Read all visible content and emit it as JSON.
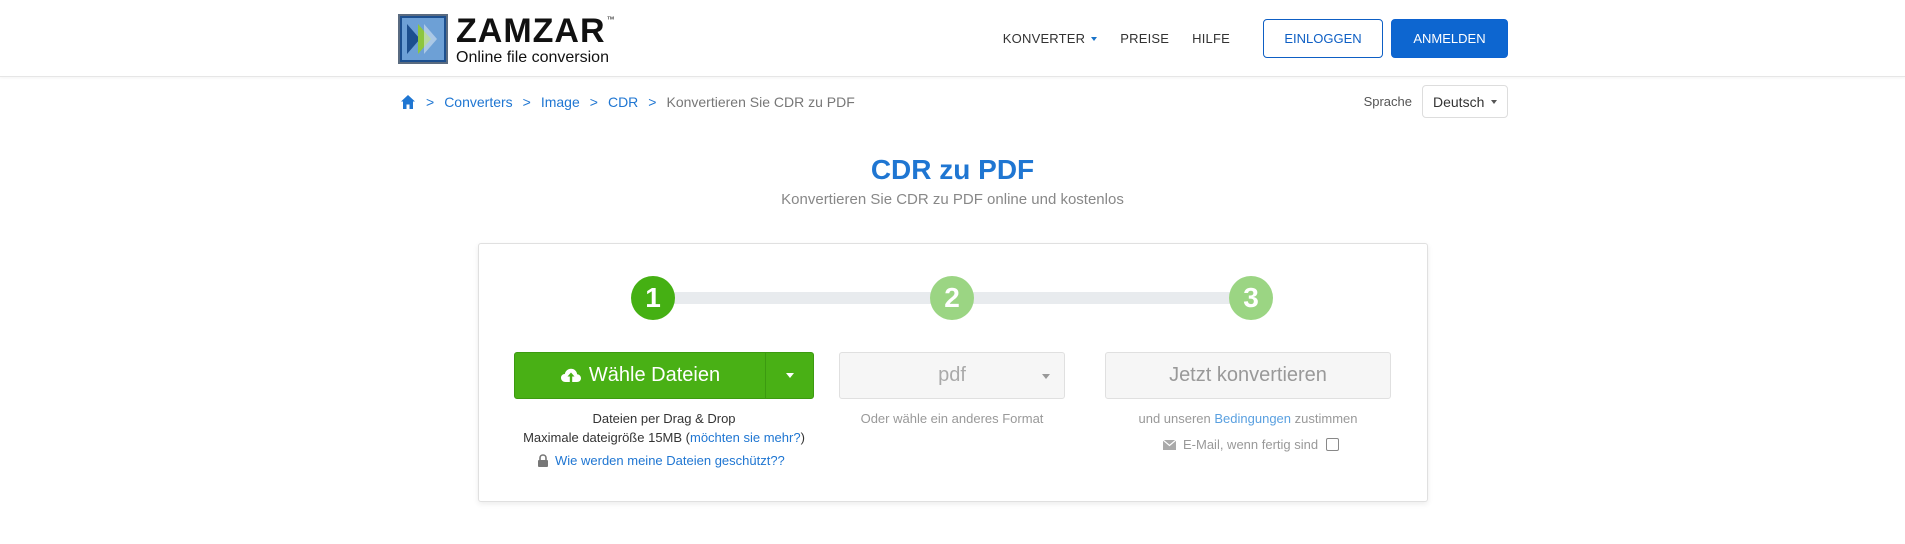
{
  "brand": {
    "name": "ZAMZAR",
    "tm": "™",
    "tagline": "Online file conversion"
  },
  "nav": {
    "converter": "KONVERTER",
    "prices": "PREISE",
    "help": "HILFE",
    "login": "EINLOGGEN",
    "signup": "ANMELDEN"
  },
  "breadcrumb": {
    "items": [
      "Converters",
      "Image",
      "CDR"
    ],
    "current": "Konvertieren Sie CDR zu PDF",
    "separator": ">"
  },
  "language": {
    "label": "Sprache",
    "value": "Deutsch"
  },
  "page": {
    "title": "CDR zu PDF",
    "subtitle": "Konvertieren Sie CDR zu PDF online und kostenlos"
  },
  "steps": [
    "1",
    "2",
    "3"
  ],
  "upload": {
    "button": "Wähle Dateien",
    "drag": "Dateien per Drag & Drop",
    "max_prefix": "Maximale dateigröße 15MB (",
    "max_link": "möchten sie mehr?",
    "max_suffix": ")",
    "protect": "Wie werden meine Dateien geschützt??"
  },
  "format": {
    "value": "pdf",
    "hint": "Oder wähle ein anderes Format"
  },
  "convert": {
    "button": "Jetzt konvertieren",
    "terms_prefix": "und unseren ",
    "terms_link": "Bedingungen",
    "terms_suffix": " zustimmen",
    "email_label": "E-Mail, wenn fertig sind"
  },
  "colors": {
    "primary_blue": "#0d66d0",
    "link_blue": "#1f76d2",
    "green": "#49b015",
    "green_light": "#9bd583"
  }
}
